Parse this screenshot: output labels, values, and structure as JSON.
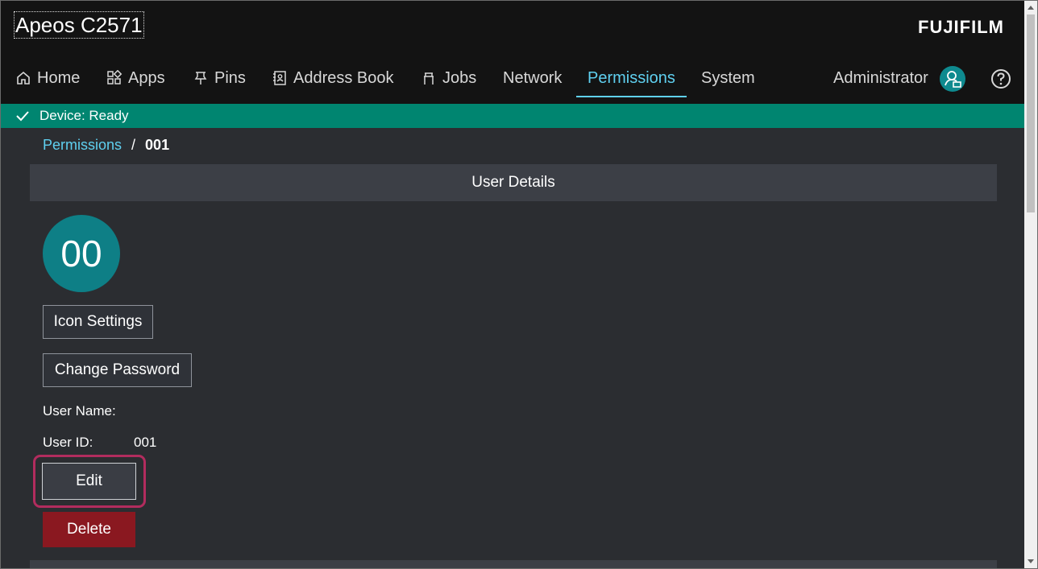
{
  "header": {
    "device_title": "Apeos C2571",
    "brand": "FUJIFILM",
    "nav": [
      {
        "label": "Home",
        "icon": "home-icon"
      },
      {
        "label": "Apps",
        "icon": "apps-icon"
      },
      {
        "label": "Pins",
        "icon": "pin-icon"
      },
      {
        "label": "Address Book",
        "icon": "address-book-icon"
      },
      {
        "label": "Jobs",
        "icon": "jobs-icon"
      },
      {
        "label": "Network",
        "icon": ""
      },
      {
        "label": "Permissions",
        "icon": "",
        "active": true
      },
      {
        "label": "System",
        "icon": ""
      }
    ],
    "user": "Administrator"
  },
  "status": {
    "text": "Device: Ready",
    "color": "#008570"
  },
  "breadcrumb": {
    "parent": "Permissions",
    "separator": "/",
    "current": "001"
  },
  "section": {
    "title": "User Details"
  },
  "user": {
    "avatar_text": "00",
    "icon_settings_label": "Icon Settings",
    "change_password_label": "Change Password",
    "user_name_label": "User Name:",
    "user_name_value": "",
    "user_id_label": "User ID:",
    "user_id_value": "001",
    "edit_label": "Edit",
    "delete_label": "Delete"
  },
  "colors": {
    "accent": "#5fd0f0",
    "avatar": "#0e7f86",
    "delete": "#8a1820",
    "focus": "#b22c5e"
  }
}
